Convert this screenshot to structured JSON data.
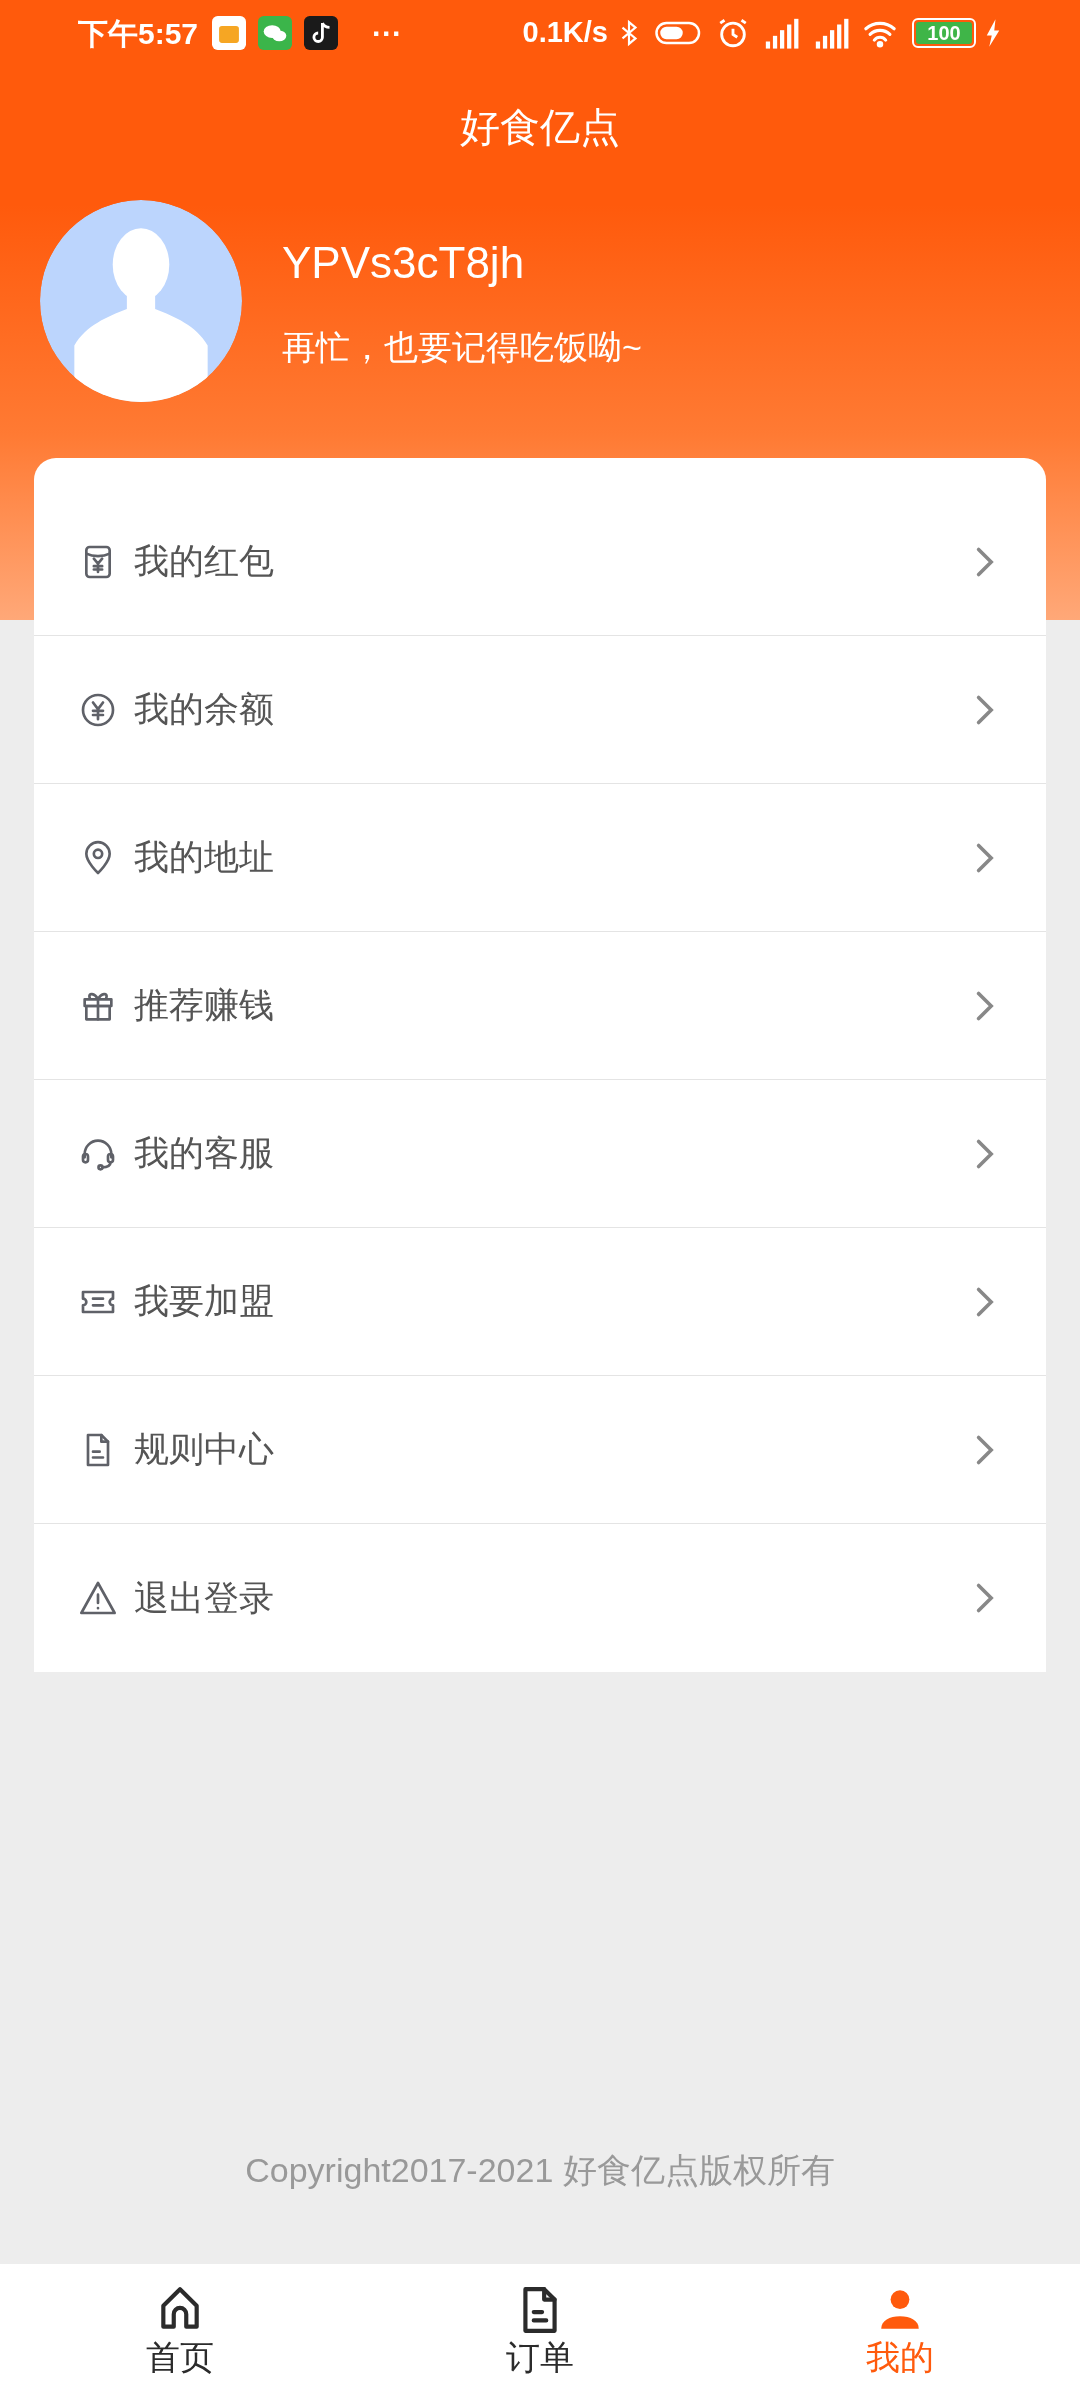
{
  "status_bar": {
    "time": "下午5:57",
    "more": "···",
    "net_speed": "0.1K/s",
    "battery": "100"
  },
  "header": {
    "title": "好食亿点"
  },
  "profile": {
    "username": "YPVs3cT8jh",
    "slogan": "再忙，也要记得吃饭呦~"
  },
  "menu": [
    {
      "kind": "red-packet",
      "label": "我的红包"
    },
    {
      "kind": "balance",
      "label": "我的余额"
    },
    {
      "kind": "address",
      "label": "我的地址"
    },
    {
      "kind": "gift",
      "label": "推荐赚钱"
    },
    {
      "kind": "service",
      "label": "我的客服"
    },
    {
      "kind": "join",
      "label": "我要加盟"
    },
    {
      "kind": "rules",
      "label": "规则中心"
    },
    {
      "kind": "logout",
      "label": "退出登录"
    }
  ],
  "footer": {
    "copyright": "Copyright2017-2021 好食亿点版权所有"
  },
  "tab_bar": [
    {
      "kind": "home",
      "label": "首页",
      "selected": false
    },
    {
      "kind": "orders",
      "label": "订单",
      "selected": false
    },
    {
      "kind": "profile",
      "label": "我的",
      "selected": true
    }
  ]
}
